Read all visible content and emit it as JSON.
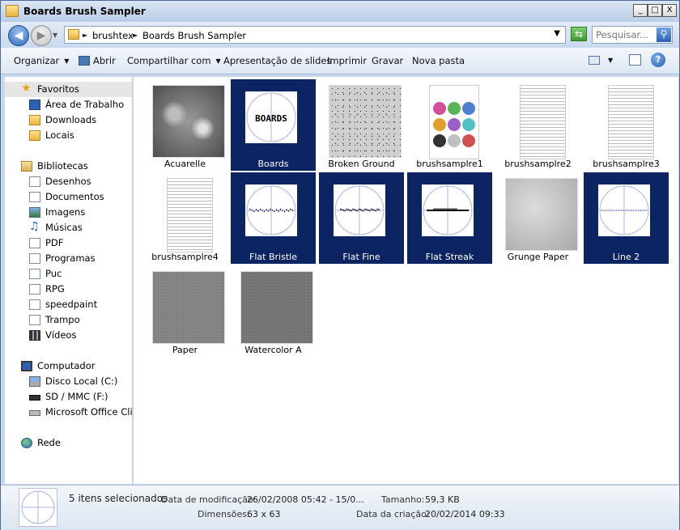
{
  "window": {
    "title": "Boards Brush Sampler",
    "buttons": {
      "minimize": "_",
      "maximize": "□",
      "close": "X"
    }
  },
  "address": {
    "crumbs": [
      "brushtex",
      "Boards Brush Sampler"
    ],
    "search_placeholder": "Pesquisar..."
  },
  "toolbar": {
    "organize": "Organizar",
    "open": "Abrir",
    "share": "Compartilhar com",
    "slideshow": "Apresentação de slides",
    "print": "Imprimir",
    "burn": "Gravar",
    "new_folder": "Nova pasta"
  },
  "sidebar": {
    "favorites": {
      "header": "Favoritos",
      "items": [
        "Área de Trabalho",
        "Downloads",
        "Locais"
      ]
    },
    "libraries": {
      "header": "Bibliotecas",
      "items": [
        "Desenhos",
        "Documentos",
        "Imagens",
        "Músicas",
        "PDF",
        "Programas",
        "Puc",
        "RPG",
        "speedpaint",
        "Trampo",
        "Vídeos"
      ]
    },
    "computer": {
      "header": "Computador",
      "items": [
        "Disco Local (C:)",
        "SD / MMC (F:)",
        "Microsoft Office Clique"
      ]
    },
    "network": {
      "header": "Rede"
    }
  },
  "files": [
    {
      "name": "Acuarelle",
      "selected": false,
      "kind": "texture-dark"
    },
    {
      "name": "Boards",
      "selected": true,
      "kind": "brush-boards"
    },
    {
      "name": "Broken Ground",
      "selected": false,
      "kind": "texture-speckle"
    },
    {
      "name": "brushsamplre1",
      "selected": false,
      "kind": "sample-color"
    },
    {
      "name": "brushsamplre2",
      "selected": false,
      "kind": "sample-doc"
    },
    {
      "name": "brushsamplre3",
      "selected": false,
      "kind": "sample-doc"
    },
    {
      "name": "brushsamplre4",
      "selected": false,
      "kind": "sample-doc"
    },
    {
      "name": "Flat Bristle",
      "selected": true,
      "kind": "brush-bristle"
    },
    {
      "name": "Flat Fine",
      "selected": true,
      "kind": "brush-fine"
    },
    {
      "name": "Flat Streak",
      "selected": true,
      "kind": "brush-streak"
    },
    {
      "name": "Grunge Paper",
      "selected": false,
      "kind": "texture-light"
    },
    {
      "name": "Line 2",
      "selected": true,
      "kind": "brush-line"
    },
    {
      "name": "Paper",
      "selected": false,
      "kind": "texture-gray"
    },
    {
      "name": "Watercolor A",
      "selected": false,
      "kind": "texture-gray2"
    }
  ],
  "status": {
    "selected_count": "5 itens selecionados",
    "modified_label": "Data de modificação:",
    "modified_value": "26/02/2008 05:42 - 15/0...",
    "size_label": "Tamanho:",
    "size_value": "59,3 KB",
    "dims_label": "Dimensões:",
    "dims_value": "63 x 63",
    "created_label": "Data da criação:",
    "created_value": "20/02/2014 09:33"
  },
  "colors": {
    "selection": "#0c2461",
    "window_frame": "#c9d7ea"
  }
}
